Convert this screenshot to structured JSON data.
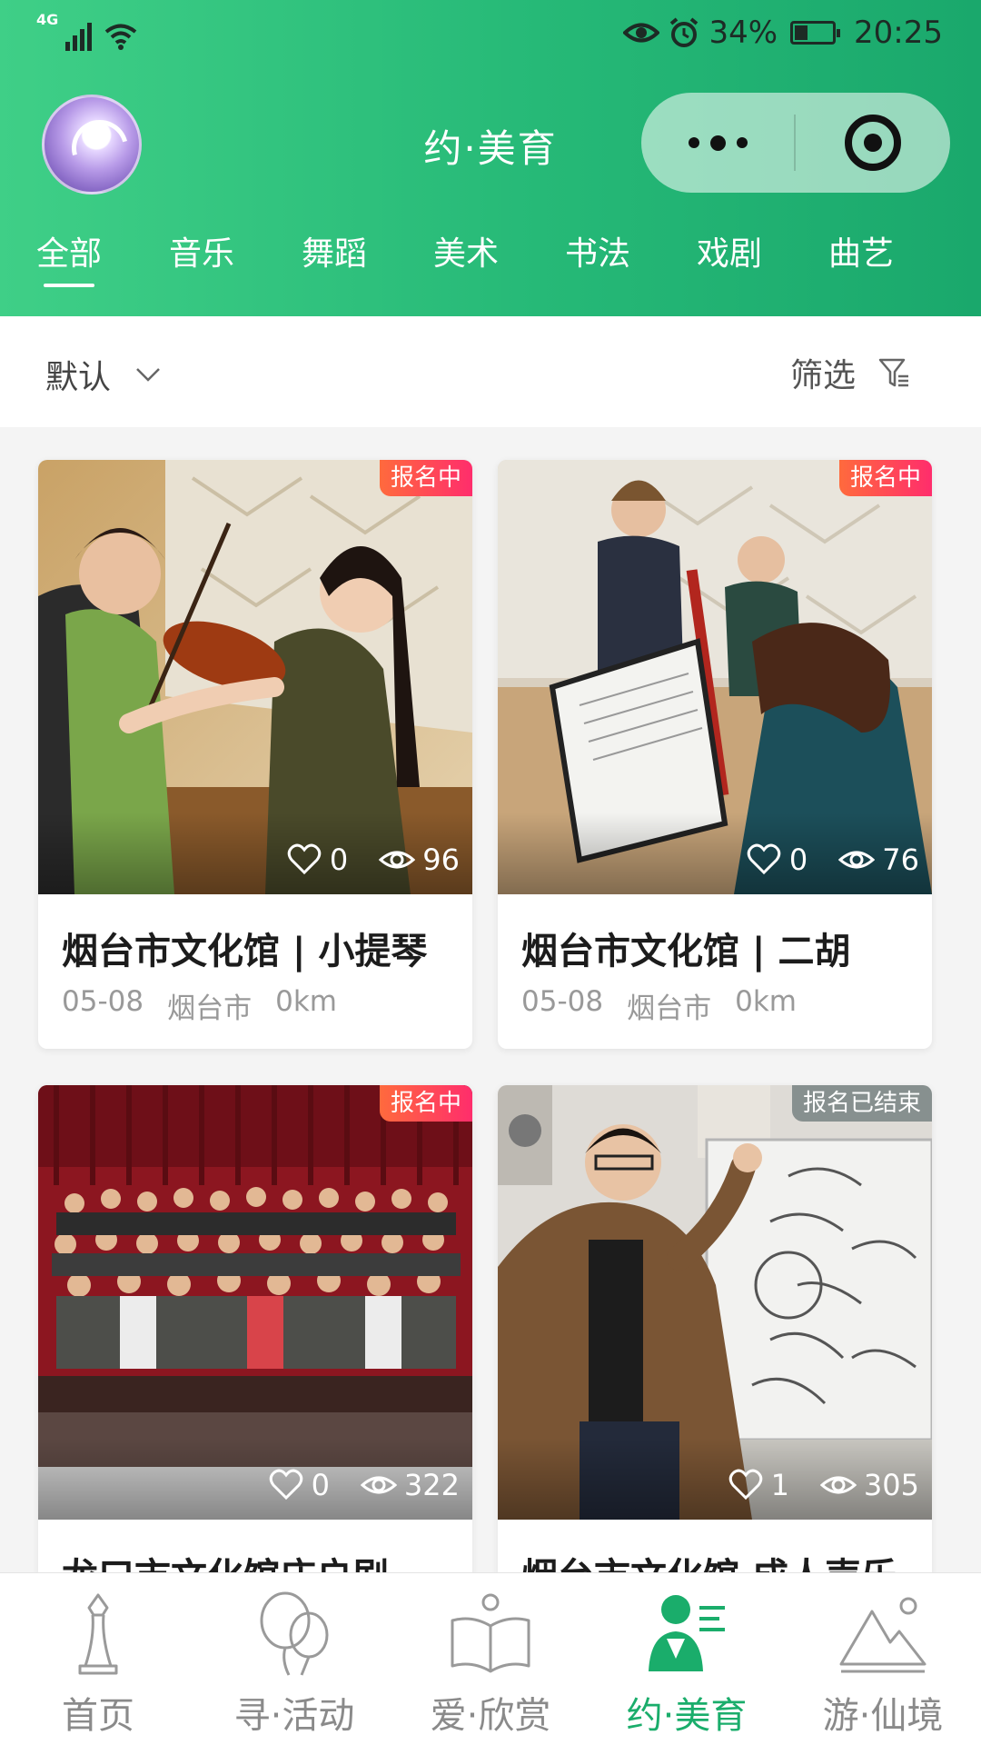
{
  "status_bar": {
    "network": "4G",
    "battery_percent": "34%",
    "battery_level": 0.34,
    "time": "20:25",
    "icons": [
      "signal-icon",
      "wifi-icon",
      "eye-icon",
      "alarm-icon",
      "battery-icon"
    ]
  },
  "header": {
    "title": "约·美育",
    "capsule_icons": [
      "more-icon",
      "target-icon"
    ]
  },
  "category_tabs": [
    {
      "label": "全部",
      "active": true
    },
    {
      "label": "音乐"
    },
    {
      "label": "舞蹈"
    },
    {
      "label": "美术"
    },
    {
      "label": "书法"
    },
    {
      "label": "戏剧"
    },
    {
      "label": "曲艺"
    }
  ],
  "sort_bar": {
    "sort_label": "默认",
    "filter_label": "筛选"
  },
  "cards": [
    {
      "status": "报名中",
      "status_type": "open",
      "likes": "0",
      "views": "96",
      "title": "烟台市文化馆 | 小提琴",
      "date": "05-08",
      "city": "烟台市",
      "distance": "0km"
    },
    {
      "status": "报名中",
      "status_type": "open",
      "likes": "0",
      "views": "76",
      "title": "烟台市文化馆 | 二胡",
      "date": "05-08",
      "city": "烟台市",
      "distance": "0km"
    },
    {
      "status": "报名中",
      "status_type": "open",
      "likes": "0",
      "views": "322",
      "title": "龙口市文化馆庄户剧",
      "date": "",
      "city": "",
      "distance": ""
    },
    {
      "status": "报名已结束",
      "status_type": "ended",
      "likes": "1",
      "views": "305",
      "title": "烟台市文化馆 成人声乐",
      "date": "",
      "city": "",
      "distance": ""
    }
  ],
  "tabbar": [
    {
      "label": "首页",
      "icon": "chess-icon"
    },
    {
      "label": "寻·活动",
      "icon": "balloons-icon"
    },
    {
      "label": "爱·欣赏",
      "icon": "book-icon"
    },
    {
      "label": "约·美育",
      "icon": "teacher-icon",
      "active": true
    },
    {
      "label": "游·仙境",
      "icon": "mountain-icon"
    }
  ],
  "colors": {
    "brand_green": "#1aad6b",
    "header_gradient_start": "#3fcf87",
    "header_gradient_end": "#1aa86c",
    "tag_open": "#ff2d6c",
    "tag_ended": "#7f8787"
  }
}
